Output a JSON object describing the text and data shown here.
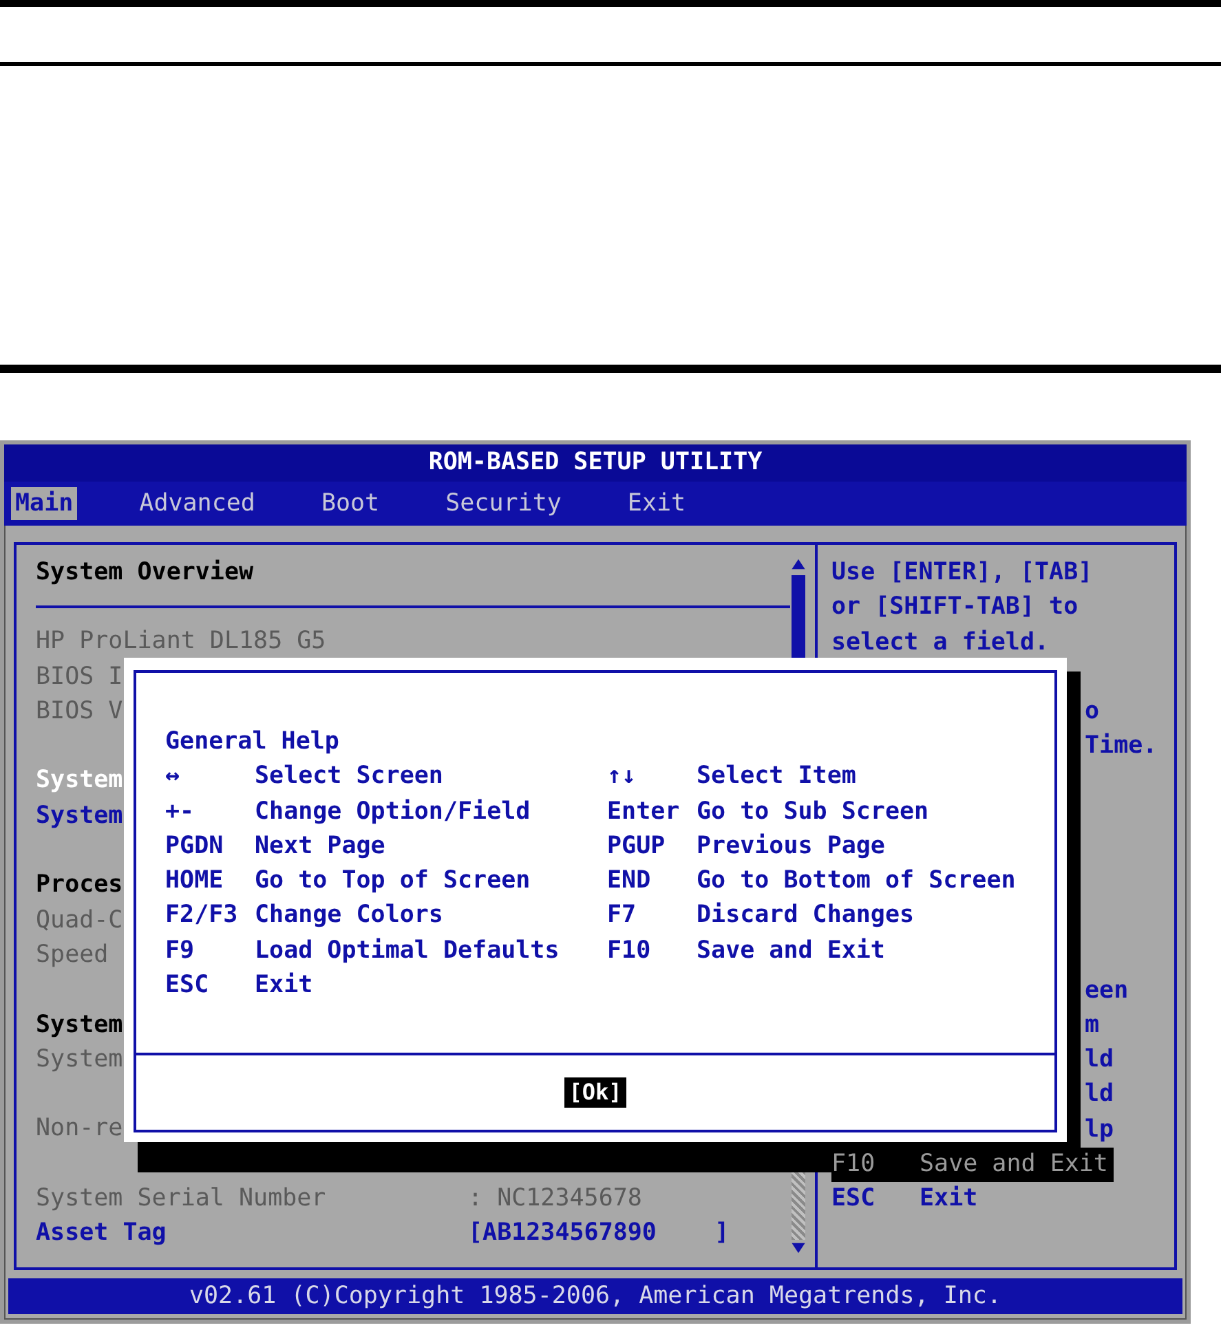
{
  "title": "ROM-BASED SETUP UTILITY",
  "tabs": [
    {
      "label": "Main",
      "selected": true
    },
    {
      "label": "Advanced",
      "selected": false
    },
    {
      "label": "Boot",
      "selected": false
    },
    {
      "label": "Security",
      "selected": false
    },
    {
      "label": "Exit",
      "selected": false
    }
  ],
  "left_panel": {
    "heading": "System Overview",
    "lines": [
      {
        "kind": "info",
        "text": "HP ProLiant DL185 G5"
      },
      {
        "kind": "info",
        "text": "BIOS I"
      },
      {
        "kind": "info",
        "text": "BIOS V"
      },
      {
        "kind": "blank"
      },
      {
        "kind": "selected",
        "text": "System"
      },
      {
        "kind": "item",
        "text": "System"
      },
      {
        "kind": "blank"
      },
      {
        "kind": "header",
        "text": "Proces"
      },
      {
        "kind": "info",
        "text": "Quad-C"
      },
      {
        "kind": "info",
        "text": "Speed"
      },
      {
        "kind": "blank"
      },
      {
        "kind": "header",
        "text": "System"
      },
      {
        "kind": "info",
        "text": "System"
      },
      {
        "kind": "blank"
      },
      {
        "kind": "info",
        "text": "Non-re"
      },
      {
        "kind": "blank"
      },
      {
        "kind": "info",
        "text": "System Serial Number",
        "value": ": NC12345678"
      },
      {
        "kind": "item",
        "text": "Asset Tag",
        "value": "[AB1234567890    ]"
      }
    ]
  },
  "right_panel": {
    "lines": [
      {
        "kind": "text",
        "text": "Use [ENTER], [TAB]"
      },
      {
        "kind": "text",
        "text": "or [SHIFT-TAB] to"
      },
      {
        "kind": "text",
        "text": "select a field."
      },
      {
        "kind": "blank"
      },
      {
        "kind": "fragment",
        "text": "o"
      },
      {
        "kind": "fragment",
        "text": "Time."
      },
      {
        "kind": "blank"
      },
      {
        "kind": "blank"
      },
      {
        "kind": "blank"
      },
      {
        "kind": "blank"
      },
      {
        "kind": "blank"
      },
      {
        "kind": "blank"
      },
      {
        "kind": "fragment",
        "text": "een"
      },
      {
        "kind": "fragment",
        "text": "m"
      },
      {
        "kind": "fragment",
        "text": "ld"
      },
      {
        "kind": "fragment",
        "text": "ld"
      },
      {
        "kind": "fragment",
        "text": "lp"
      },
      {
        "kind": "dimmed-key",
        "key": "F10",
        "text": "Save and Exit"
      },
      {
        "kind": "key",
        "key": "ESC",
        "text": "Exit"
      }
    ]
  },
  "help_dialog": {
    "title": "General Help",
    "rows": [
      {
        "key": "↔",
        "desc": "Select Screen",
        "key2": "↑↓",
        "desc2": "Select Item"
      },
      {
        "key": "+-",
        "desc": "Change Option/Field",
        "key2": "Enter",
        "desc2": "Go to Sub Screen"
      },
      {
        "key": "PGDN",
        "desc": "Next Page",
        "key2": "PGUP",
        "desc2": "Previous Page"
      },
      {
        "key": "HOME",
        "desc": "Go to Top of Screen",
        "key2": "END",
        "desc2": "Go to Bottom of Screen"
      },
      {
        "key": "F2/F3",
        "desc": "Change Colors",
        "key2": "F7",
        "desc2": "Discard Changes"
      },
      {
        "key": "F9",
        "desc": "Load Optimal Defaults",
        "key2": "F10",
        "desc2": "Save and Exit"
      },
      {
        "key": "ESC",
        "desc": "Exit"
      }
    ],
    "ok_button": "[Ok]"
  },
  "footer": "v02.61 (C)Copyright 1985-2006, American Megatrends, Inc."
}
